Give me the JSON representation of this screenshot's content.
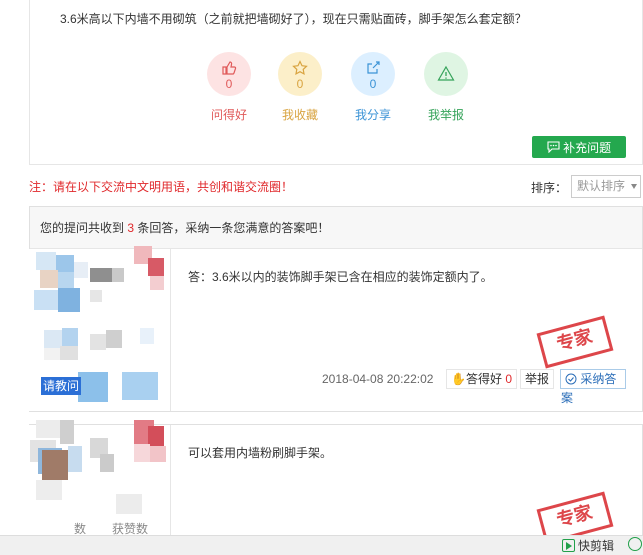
{
  "question": {
    "text": "3.6米高以下内墙不用砌筑（之前就把墙砌好了），现在只需贴面砖，脚手架怎么套定额？"
  },
  "actions": [
    {
      "label": "问得好",
      "count": "0",
      "color": "#e05a5a",
      "bg": "#fde3e3",
      "icon": "thumb-up-icon"
    },
    {
      "label": "我收藏",
      "count": "0",
      "color": "#d9a441",
      "bg": "#fcefc9",
      "icon": "star-icon"
    },
    {
      "label": "我分享",
      "count": "0",
      "color": "#3b93d6",
      "bg": "#dcefff",
      "icon": "share-icon"
    },
    {
      "label": "我举报",
      "count": "",
      "color": "#35a35a",
      "bg": "#dff5e3",
      "icon": "warning-icon"
    }
  ],
  "supplement_button": "补充问题",
  "notice": "注：请在以下交流中文明用语，共创和谐交流圈！",
  "sort": {
    "label": "排序：",
    "selected": "默认排序"
  },
  "answers_header": {
    "prefix": "您的提问共收到 ",
    "count": "3",
    "suffix": " 条回答，采纳一条您满意的答案吧！"
  },
  "answers": [
    {
      "text": "答：3.6米以内的装饰脚手架已含在相应的装饰定额内了。",
      "date": "2018-04-08 20:22:02",
      "good_label": "答得好",
      "good_count": "0",
      "report_label": "举报",
      "adopt_label": "采纳答",
      "adopt_label_2": "案",
      "stamp": "专家"
    },
    {
      "text": "可以套用内墙粉刷脚手架。",
      "stamp": "专家"
    }
  ],
  "sidebar": {
    "ask_button": "请教问",
    "stat_1": "数",
    "stat_2": "获赞数"
  },
  "bottombar": {
    "edit_label": "快剪辑"
  },
  "colors": {
    "accent_green": "#24a84e",
    "red": "#e0292c",
    "blue": "#2a6db8"
  }
}
